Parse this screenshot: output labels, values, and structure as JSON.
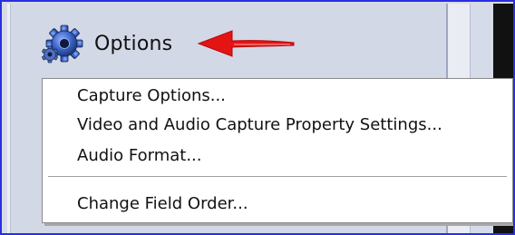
{
  "header": {
    "title": "Options",
    "icon": "gear-icon",
    "pointer": "red-arrow-icon"
  },
  "menu": {
    "items": [
      {
        "label": "Capture Options..."
      },
      {
        "label": "Video and Audio Capture Property Settings..."
      },
      {
        "label": "Audio Format..."
      },
      {
        "label": "Change Field Order..."
      }
    ]
  },
  "colors": {
    "frame_border": "#2a2ee0",
    "panel_bg": "#d3d8e6",
    "menu_bg": "#ffffff",
    "arrow": "#e41414",
    "gear": "#2b4e9e"
  }
}
